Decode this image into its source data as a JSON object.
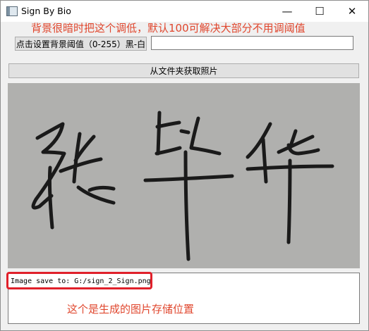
{
  "window": {
    "title": "Sign By Bio",
    "controls": {
      "minimize": "—",
      "maximize": "☐",
      "close": "✕"
    }
  },
  "annotations": {
    "top_note": "背景很暗时把这个调低，默认100可解决大部分不用调阈值",
    "bottom_note": "这个是生成的图片存储位置"
  },
  "controls": {
    "threshold_button_label": "点击设置背景阈值（0-255）黑-白",
    "threshold_input_value": "",
    "open_folder_button_label": "从文件夹获取照片"
  },
  "image": {
    "description_icon": "handwritten-signature-image"
  },
  "log": {
    "text": "Image save to: G:/sign_2_Sign.png"
  },
  "colors": {
    "annotation": "#e0472e",
    "highlight_box": "#e0202a",
    "image_background": "#b0b0ae",
    "ink": "#1a1a1a"
  }
}
